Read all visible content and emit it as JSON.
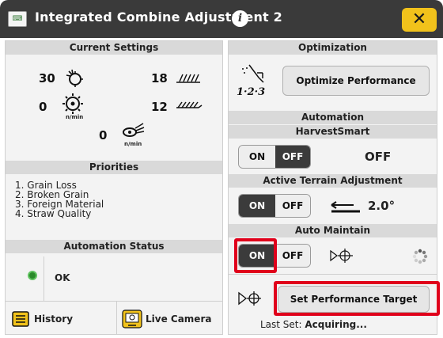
{
  "window": {
    "title": "Integrated Combine Adjustment 2",
    "info_icon": "info-icon",
    "close_label": "✕"
  },
  "current_settings": {
    "header": "Current Settings",
    "readouts": [
      {
        "value": "30",
        "icon": "rotor-speed-icon"
      },
      {
        "value": "18",
        "icon": "concave-icon"
      },
      {
        "value": "0",
        "icon": "fan-icon",
        "unit": "n/min"
      },
      {
        "value": "12",
        "icon": "sieve-icon"
      },
      {
        "value": "0",
        "icon": "chopper-icon",
        "unit": "n/min"
      }
    ]
  },
  "priorities": {
    "header": "Priorities",
    "items": [
      "1. Grain Loss",
      "2. Broken Grain",
      "3. Foreign Material",
      "4. Straw Quality"
    ]
  },
  "automation_status": {
    "header": "Automation Status",
    "status_text": "OK",
    "status_color": "#2a8a2a"
  },
  "bottom_buttons": {
    "history_label": "History",
    "live_camera_label": "Live Camera"
  },
  "optimization": {
    "header": "Optimization",
    "button_label": "Optimize Performance",
    "icon_label": "1·2·3"
  },
  "automation": {
    "header": "Automation",
    "harvestsmart": {
      "header": "HarvestSmart",
      "on_label": "ON",
      "off_label": "OFF",
      "selected": "OFF",
      "value": "OFF"
    },
    "active_terrain": {
      "header": "Active Terrain Adjustment",
      "on_label": "ON",
      "off_label": "OFF",
      "selected": "ON",
      "value": "2.0°"
    },
    "auto_maintain": {
      "header": "Auto Maintain",
      "on_label": "ON",
      "off_label": "OFF",
      "selected": "ON"
    },
    "performance_target": {
      "button_label": "Set Performance Target",
      "last_set_label": "Last Set:",
      "last_set_value": "Acquiring..."
    }
  },
  "colors": {
    "titlebar": "#3a3a3a",
    "close_button": "#f1c21b",
    "highlight_red": "#e0001b",
    "toggle_on": "#3b3b3b",
    "history_icon": "#f1c21b"
  }
}
